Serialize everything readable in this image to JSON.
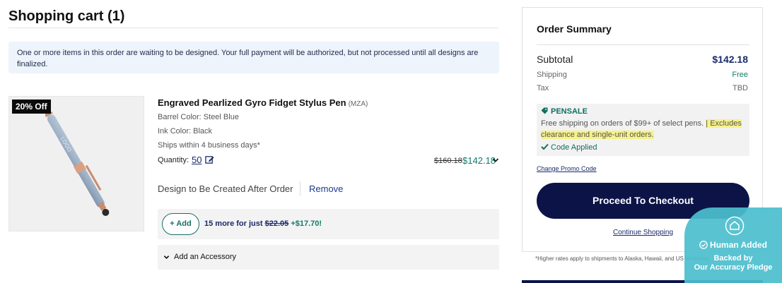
{
  "cart": {
    "title": "Shopping cart (1)",
    "notice": "One or more items in this order are waiting to be designed. Your full payment will be authorized, but not processed until all designs are finalized."
  },
  "item": {
    "badge": "20% Off",
    "name": "Engraved Pearlized Gyro Fidget Stylus Pen",
    "sku": "(MZA)",
    "barrel_color": "Barrel Color: Steel Blue",
    "ink_color": "Ink Color: Black",
    "ships": "Ships within 4 business days*",
    "quantity_label": "Quantity:",
    "quantity": "50",
    "price_original": "$160.18",
    "price_current": "$142.18",
    "design_note": "Design to Be Created After Order",
    "remove_label": "Remove",
    "upsell": {
      "button": "+ Add",
      "text_prefix": "15 more for just",
      "price_strike": "$22.05",
      "price_new": "+$17.70!"
    },
    "accessory_label": "Add an Accessory"
  },
  "summary": {
    "title": "Order Summary",
    "subtotal_label": "Subtotal",
    "subtotal_value": "$142.18",
    "shipping_label": "Shipping",
    "shipping_value": "Free",
    "tax_label": "Tax",
    "tax_value": "TBD",
    "promo": {
      "code": "PENSALE",
      "desc_plain": "Free shipping on orders of $99+ of select pens.",
      "desc_highlight": "| Excludes clearance and single-unit orders.",
      "applied": "Code Applied"
    },
    "change_promo": "Change Promo Code",
    "checkout": "Proceed To Checkout",
    "continue": "Continue Shopping"
  },
  "footnote": "*Higher rates apply to shipments to Alaska, Hawaii, and US territories.",
  "human_badge": {
    "line1": "Human Added",
    "line2": "Backed by",
    "line3": "Our Accuracy Pledge"
  },
  "colors": {
    "navy": "#0c1447",
    "teal": "#0f7c6a",
    "notice_bg": "#eef4fb",
    "highlight": "#f6f28a",
    "badge_bg": "#4cbece"
  }
}
